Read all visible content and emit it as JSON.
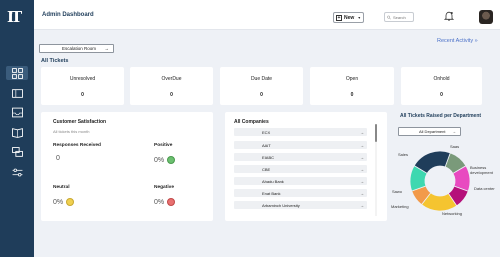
{
  "header": {
    "title": "Admin Dashboard",
    "new_label": "New",
    "search_placeholder": "Search"
  },
  "escalation_label": "Escalation Room",
  "recent_activity": "Recent Activity »",
  "all_tickets_label": "All Tickets",
  "stats": [
    {
      "label": "Unresolved",
      "value": "0"
    },
    {
      "label": "OverDue",
      "value": "0"
    },
    {
      "label": "Due Date",
      "value": "0"
    },
    {
      "label": "Open",
      "value": "0"
    },
    {
      "label": "Onhold",
      "value": "0"
    }
  ],
  "satisfaction": {
    "title": "Customer Satisfaction",
    "subtitle": "All tickets this month",
    "responses_label": "Responses Received",
    "responses_value": "0",
    "positive_label": "Positive",
    "positive_value": "0%",
    "neutral_label": "Neutral",
    "neutral_value": "0%",
    "negative_label": "Negative",
    "negative_value": "0%"
  },
  "companies": {
    "title": "All Companies",
    "items": [
      "ECX",
      "AAiT",
      "EIABC",
      "CBE",
      "Ahadu Bank",
      "Enat Bank",
      "Arbaminch University"
    ]
  },
  "department": {
    "title": "All Tickets Raised per Department",
    "filter_label": "All Department"
  },
  "chart_data": {
    "type": "pie",
    "categories": [
      "Sales",
      "Business development",
      "Data center",
      "Networking",
      "Marketing",
      "Sawo",
      "Saas"
    ],
    "values": [
      11,
      14,
      10,
      20,
      9,
      14,
      22
    ],
    "colors": [
      "#7a9a7a",
      "#e84ac0",
      "#b5107a",
      "#f5c430",
      "#f29a4a",
      "#3ed8b0",
      "#1f3d5a"
    ],
    "title": "All Tickets Raised per Department"
  },
  "colors": {
    "sidebar": "#1f3d5a",
    "accent_link": "#4a70c8",
    "positive_face": "#6cc070",
    "neutral_face": "#f0d050",
    "negative_face": "#e87070"
  }
}
